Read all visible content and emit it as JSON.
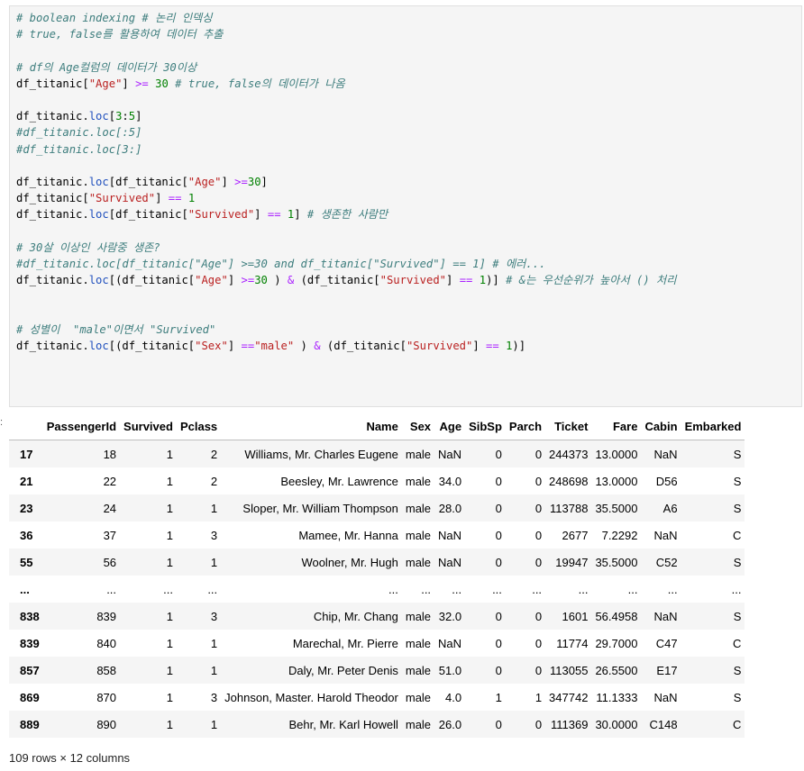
{
  "code_lines": [
    [
      {
        "t": "# boolean indexing # 논리 인덱싱",
        "k": "c"
      }
    ],
    [
      {
        "t": "# true, false를 활용하여 데이터 추출",
        "k": "c"
      }
    ],
    [],
    [
      {
        "t": "# df의 Age컬럼의 데이터가 30이상",
        "k": "c"
      }
    ],
    [
      {
        "t": "df_titanic["
      },
      {
        "t": "\"Age\"",
        "k": "s"
      },
      {
        "t": "] "
      },
      {
        "t": ">=",
        "k": "o"
      },
      {
        "t": " "
      },
      {
        "t": "30",
        "k": "n"
      },
      {
        "t": " "
      },
      {
        "t": "# true, false의 데이터가 나옴",
        "k": "c"
      }
    ],
    [],
    [
      {
        "t": "df_titanic."
      },
      {
        "t": "loc",
        "k": "a"
      },
      {
        "t": "["
      },
      {
        "t": "3",
        "k": "n"
      },
      {
        "t": ":"
      },
      {
        "t": "5",
        "k": "n"
      },
      {
        "t": "]"
      }
    ],
    [
      {
        "t": "#df_titanic.loc[:5]",
        "k": "c"
      }
    ],
    [
      {
        "t": "#df_titanic.loc[3:]",
        "k": "c"
      }
    ],
    [],
    [
      {
        "t": "df_titanic."
      },
      {
        "t": "loc",
        "k": "a"
      },
      {
        "t": "[df_titanic["
      },
      {
        "t": "\"Age\"",
        "k": "s"
      },
      {
        "t": "] "
      },
      {
        "t": ">=",
        "k": "o"
      },
      {
        "t": "30",
        "k": "n"
      },
      {
        "t": "]"
      }
    ],
    [
      {
        "t": "df_titanic["
      },
      {
        "t": "\"Survived\"",
        "k": "s"
      },
      {
        "t": "] "
      },
      {
        "t": "==",
        "k": "o"
      },
      {
        "t": " "
      },
      {
        "t": "1",
        "k": "n"
      }
    ],
    [
      {
        "t": "df_titanic."
      },
      {
        "t": "loc",
        "k": "a"
      },
      {
        "t": "[df_titanic["
      },
      {
        "t": "\"Survived\"",
        "k": "s"
      },
      {
        "t": "] "
      },
      {
        "t": "==",
        "k": "o"
      },
      {
        "t": " "
      },
      {
        "t": "1",
        "k": "n"
      },
      {
        "t": "] "
      },
      {
        "t": "# 생존한 사람만",
        "k": "c"
      }
    ],
    [],
    [
      {
        "t": "# 30살 이상인 사람중 생존?",
        "k": "c"
      }
    ],
    [
      {
        "t": "#df_titanic.loc[df_titanic[\"Age\"] >=30 and df_titanic[\"Survived\"] == 1] # 에러...",
        "k": "c"
      }
    ],
    [
      {
        "t": "df_titanic."
      },
      {
        "t": "loc",
        "k": "a"
      },
      {
        "t": "[(df_titanic["
      },
      {
        "t": "\"Age\"",
        "k": "s"
      },
      {
        "t": "] "
      },
      {
        "t": ">=",
        "k": "o"
      },
      {
        "t": "30",
        "k": "n"
      },
      {
        "t": " ) "
      },
      {
        "t": "&",
        "k": "o"
      },
      {
        "t": " (df_titanic["
      },
      {
        "t": "\"Survived\"",
        "k": "s"
      },
      {
        "t": "] "
      },
      {
        "t": "==",
        "k": "o"
      },
      {
        "t": " "
      },
      {
        "t": "1",
        "k": "n"
      },
      {
        "t": ")] "
      },
      {
        "t": "# &는 우선순위가 높아서 () 처리",
        "k": "c"
      }
    ],
    [],
    [],
    [
      {
        "t": "# 성별이  \"male\"이면서 \"Survived\"",
        "k": "c"
      }
    ],
    [
      {
        "t": "df_titanic."
      },
      {
        "t": "loc",
        "k": "a"
      },
      {
        "t": "[(df_titanic["
      },
      {
        "t": "\"Sex\"",
        "k": "s"
      },
      {
        "t": "] "
      },
      {
        "t": "==",
        "k": "o"
      },
      {
        "t": "\"male\"",
        "k": "s"
      },
      {
        "t": " ) "
      },
      {
        "t": "&",
        "k": "o"
      },
      {
        "t": " (df_titanic["
      },
      {
        "t": "\"Survived\"",
        "k": "s"
      },
      {
        "t": "] "
      },
      {
        "t": "==",
        "k": "o"
      },
      {
        "t": " "
      },
      {
        "t": "1",
        "k": "n"
      },
      {
        "t": ")]"
      }
    ]
  ],
  "output_marker": ":",
  "table": {
    "columns": [
      "",
      "PassengerId",
      "Survived",
      "Pclass",
      "Name",
      "Sex",
      "Age",
      "SibSp",
      "Parch",
      "Ticket",
      "Fare",
      "Cabin",
      "Embarked"
    ],
    "rows": [
      [
        "17",
        "18",
        "1",
        "2",
        "Williams, Mr. Charles Eugene",
        "male",
        "NaN",
        "0",
        "0",
        "244373",
        "13.0000",
        "NaN",
        "S"
      ],
      [
        "21",
        "22",
        "1",
        "2",
        "Beesley, Mr. Lawrence",
        "male",
        "34.0",
        "0",
        "0",
        "248698",
        "13.0000",
        "D56",
        "S"
      ],
      [
        "23",
        "24",
        "1",
        "1",
        "Sloper, Mr. William Thompson",
        "male",
        "28.0",
        "0",
        "0",
        "113788",
        "35.5000",
        "A6",
        "S"
      ],
      [
        "36",
        "37",
        "1",
        "3",
        "Mamee, Mr. Hanna",
        "male",
        "NaN",
        "0",
        "0",
        "2677",
        "7.2292",
        "NaN",
        "C"
      ],
      [
        "55",
        "56",
        "1",
        "1",
        "Woolner, Mr. Hugh",
        "male",
        "NaN",
        "0",
        "0",
        "19947",
        "35.5000",
        "C52",
        "S"
      ],
      [
        "...",
        "...",
        "...",
        "...",
        "...",
        "...",
        "...",
        "...",
        "...",
        "...",
        "...",
        "...",
        "..."
      ],
      [
        "838",
        "839",
        "1",
        "3",
        "Chip, Mr. Chang",
        "male",
        "32.0",
        "0",
        "0",
        "1601",
        "56.4958",
        "NaN",
        "S"
      ],
      [
        "839",
        "840",
        "1",
        "1",
        "Marechal, Mr. Pierre",
        "male",
        "NaN",
        "0",
        "0",
        "11774",
        "29.7000",
        "C47",
        "C"
      ],
      [
        "857",
        "858",
        "1",
        "1",
        "Daly, Mr. Peter Denis",
        "male",
        "51.0",
        "0",
        "0",
        "113055",
        "26.5500",
        "E17",
        "S"
      ],
      [
        "869",
        "870",
        "1",
        "3",
        "Johnson, Master. Harold Theodor",
        "male",
        "4.0",
        "1",
        "1",
        "347742",
        "11.1333",
        "NaN",
        "S"
      ],
      [
        "889",
        "890",
        "1",
        "1",
        "Behr, Mr. Karl Howell",
        "male",
        "26.0",
        "0",
        "0",
        "111369",
        "30.0000",
        "C148",
        "C"
      ]
    ]
  },
  "footer": "109 rows × 12 columns"
}
